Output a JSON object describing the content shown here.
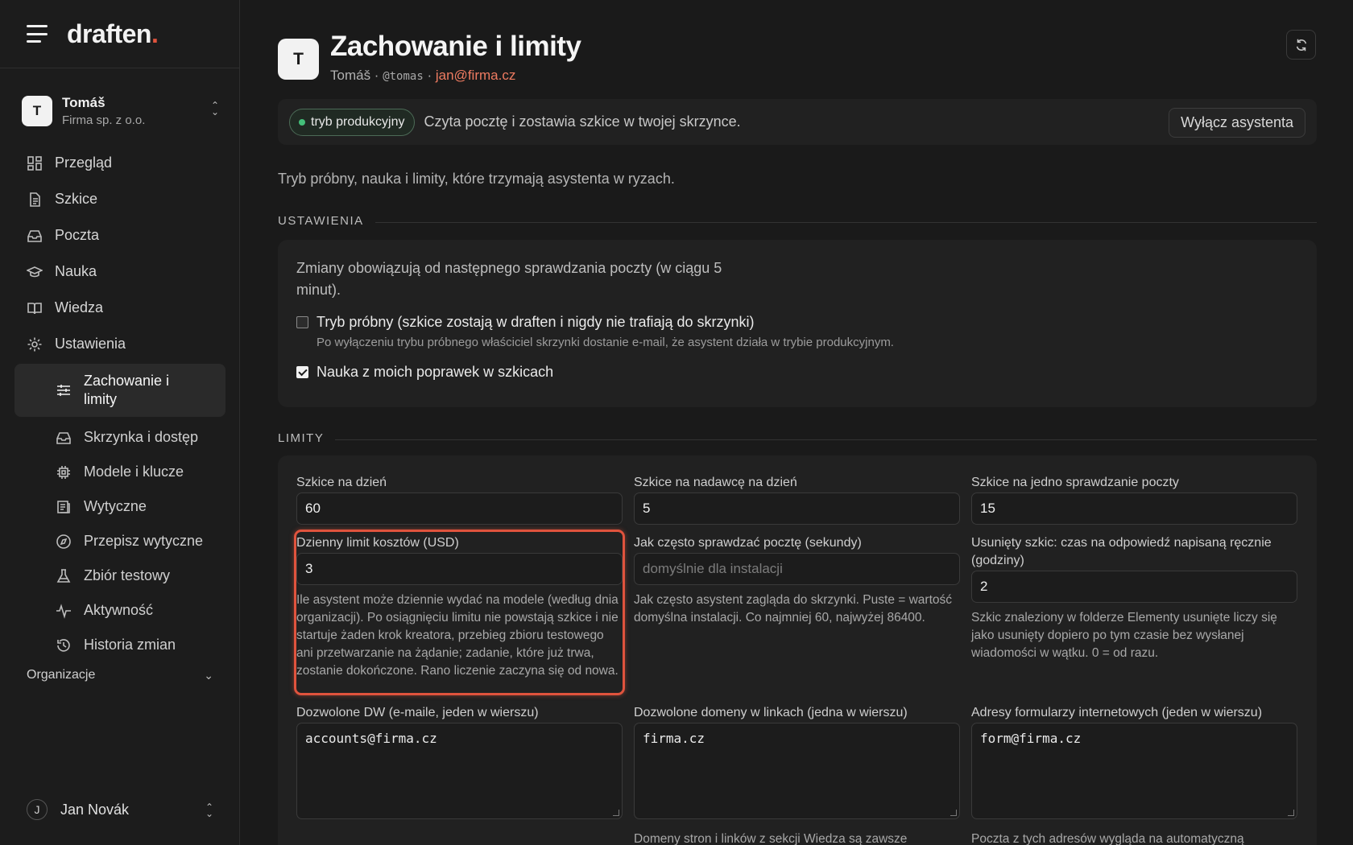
{
  "brand": {
    "name": "draften",
    "dot": "."
  },
  "account": {
    "initial": "T",
    "name": "Tomáš",
    "org": "Firma sp. z o.o."
  },
  "nav": {
    "items": [
      {
        "label": "Przegląd",
        "icon": "dashboard-icon"
      },
      {
        "label": "Szkice",
        "icon": "document-icon"
      },
      {
        "label": "Poczta",
        "icon": "inbox-icon"
      },
      {
        "label": "Nauka",
        "icon": "graduation-cap-icon"
      },
      {
        "label": "Wiedza",
        "icon": "book-icon"
      },
      {
        "label": "Ustawienia",
        "icon": "gear-icon"
      }
    ],
    "sub_items": [
      {
        "label": "Zachowanie i limity",
        "icon": "sliders-icon",
        "active": true
      },
      {
        "label": "Skrzynka i dostęp",
        "icon": "inbox-icon"
      },
      {
        "label": "Modele i klucze",
        "icon": "chip-icon"
      },
      {
        "label": "Wytyczne",
        "icon": "list-icon"
      },
      {
        "label": "Przepisz wytyczne",
        "icon": "compass-icon"
      },
      {
        "label": "Zbiór testowy",
        "icon": "flask-icon"
      },
      {
        "label": "Aktywność",
        "icon": "activity-icon"
      },
      {
        "label": "Historia zmian",
        "icon": "history-icon"
      }
    ],
    "org_section": "Organizacje"
  },
  "user": {
    "initial": "J",
    "name": "Jan Novák"
  },
  "header": {
    "initial": "T",
    "title": "Zachowanie i limity",
    "name": "Tomáš",
    "sep1": " · ",
    "handle": "@tomas",
    "sep2": " · ",
    "email": "jan@firma.cz"
  },
  "status": {
    "badge": "tryb produkcyjny",
    "text": "Czyta pocztę i zostawia szkice w twojej skrzynce.",
    "button": "Wyłącz asystenta"
  },
  "intro": "Tryb próbny, nauka i limity, które trzymają asystenta w ryzach.",
  "settings": {
    "heading": "USTAWIENIA",
    "note": "Zmiany obowiązują od następnego sprawdzania poczty (w ciągu 5 minut).",
    "trial_label": "Tryb próbny (szkice zostają w draften i nigdy nie trafiają do skrzynki)",
    "trial_checked": false,
    "trial_help": "Po wyłączeniu trybu próbnego właściciel skrzynki dostanie e-mail, że asystent działa w trybie produkcyjnym.",
    "learn_label": "Nauka z moich poprawek w szkicach",
    "learn_checked": true
  },
  "limits": {
    "heading": "LIMITY",
    "drafts_per_day": {
      "label": "Szkice na dzień",
      "value": "60"
    },
    "drafts_per_sender": {
      "label": "Szkice na nadawcę na dzień",
      "value": "5"
    },
    "drafts_per_check": {
      "label": "Szkice na jedno sprawdzanie poczty",
      "value": "15"
    },
    "cost_limit": {
      "label": "Dzienny limit kosztów (USD)",
      "value": "3",
      "help": "Ile asystent może dziennie wydać na modele (według dnia organizacji). Po osiągnięciu limitu nie powstają szkice i nie startuje żaden krok kreatora, przebieg zbioru testowego ani przetwarzanie na żądanie; zadanie, które już trwa, zostanie dokończone. Rano liczenie zaczyna się od nowa."
    },
    "poll_interval": {
      "label": "Jak często sprawdzać pocztę (sekundy)",
      "placeholder": "domyślnie dla instalacji",
      "help": "Jak często asystent zagląda do skrzynki. Puste = wartość domyślna instalacji. Co najmniej 60, najwyżej 86400."
    },
    "deleted_draft": {
      "label": "Usunięty szkic: czas na odpowiedź napisaną ręcznie (godziny)",
      "value": "2",
      "help": "Szkic znaleziony w folderze Elementy usunięte liczy się jako usunięty dopiero po tym czasie bez wysłanej wiadomości w wątku. 0 = od razu."
    },
    "allowed_cc": {
      "label": "Dozwolone DW (e-maile, jeden w wierszu)",
      "value": "accounts@firma.cz"
    },
    "allowed_domains": {
      "label": "Dozwolone domeny w linkach (jedna w wierszu)",
      "value": "firma.cz",
      "help": "Domeny stron i linków z sekcji Wiedza są zawsze"
    },
    "form_addresses": {
      "label": "Adresy formularzy internetowych (jeden w wierszu)",
      "value": "form@firma.cz",
      "help": "Poczta z tych adresów wygląda na automatyczną"
    }
  },
  "colors": {
    "accent": "#e0533d",
    "email": "#ee7b61",
    "status_dot": "#44c07a"
  }
}
